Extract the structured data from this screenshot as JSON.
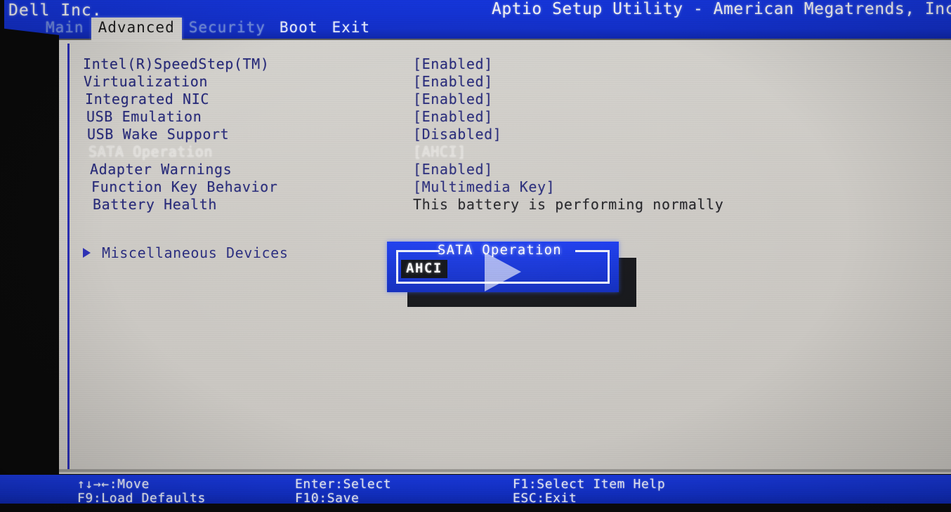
{
  "header": {
    "vendor": "Dell Inc.",
    "utility_title": "Aptio Setup Utility - American Megatrends, Inc",
    "accent_blue": "#1331d0",
    "panel_grey": "#cfcdc8"
  },
  "tabs": [
    {
      "label": "Main",
      "state": "dim"
    },
    {
      "label": "Advanced",
      "state": "active"
    },
    {
      "label": "Security",
      "state": "dim"
    },
    {
      "label": "Boot",
      "state": "plain"
    },
    {
      "label": "Exit",
      "state": "plain"
    }
  ],
  "settings": [
    {
      "label": "Intel(R)SpeedStep(TM)",
      "value": "[Enabled]",
      "dimmed": false
    },
    {
      "label": "Virtualization",
      "value": "[Enabled]",
      "dimmed": false
    },
    {
      "label": "Integrated NIC",
      "value": "[Enabled]",
      "dimmed": false
    },
    {
      "label": "USB Emulation",
      "value": "[Enabled]",
      "dimmed": false
    },
    {
      "label": "USB Wake Support",
      "value": "[Disabled]",
      "dimmed": false
    },
    {
      "label": "SATA Operation",
      "value": "[AHCI]",
      "dimmed": true
    },
    {
      "label": "Adapter Warnings",
      "value": "[Enabled]",
      "dimmed": false
    },
    {
      "label": "Function Key Behavior",
      "value": "[Multimedia Key]",
      "dimmed": false
    },
    {
      "label": "Battery Health",
      "value": "This battery is performing normally",
      "dimmed": false
    }
  ],
  "submenu": {
    "label": "Miscellaneous Devices",
    "arrow_icon": "triangle-right-icon"
  },
  "dialog": {
    "title": "SATA Operation",
    "selected_option": "AHCI"
  },
  "overlay": {
    "play_icon": "play-triangle-icon"
  },
  "status": {
    "move": "↑↓→←:Move",
    "load_defaults": "F9:Load Defaults",
    "select": "Enter:Select",
    "save": "F10:Save",
    "help": "F1:Select Item Help",
    "exit": "ESC:Exit"
  }
}
